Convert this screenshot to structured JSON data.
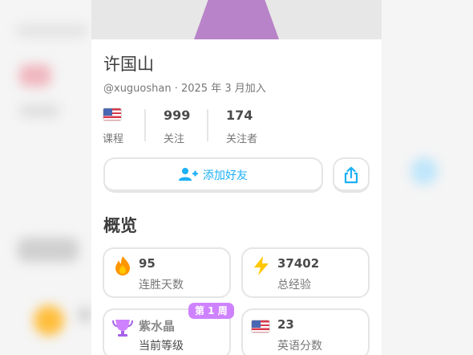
{
  "profile": {
    "name": "许国山",
    "handle_line": "@xuguoshan · 2025 年 3 月加入"
  },
  "stats": {
    "courses_label": "课程",
    "following_value": "999",
    "following_label": "关注",
    "followers_value": "174",
    "followers_label": "关注者"
  },
  "actions": {
    "add_friend_label": "添加好友"
  },
  "overview": {
    "title": "概览",
    "cards": [
      {
        "value": "95",
        "label": "连胜天数",
        "icon": "flame-icon"
      },
      {
        "value": "37402",
        "label": "总经验",
        "icon": "lightning-icon"
      },
      {
        "value": "紫水晶",
        "label": "当前等级",
        "icon": "amethyst-trophy-icon"
      },
      {
        "value": "23",
        "label": "英语分数",
        "icon": "us-flag-icon"
      }
    ],
    "badge": "第 1 周"
  },
  "colors": {
    "accent_blue": "#1cb0f6",
    "flame": "#ff9600",
    "lightning": "#ffc800",
    "amethyst": "#ce82ff",
    "avatar": "#b883c8"
  }
}
